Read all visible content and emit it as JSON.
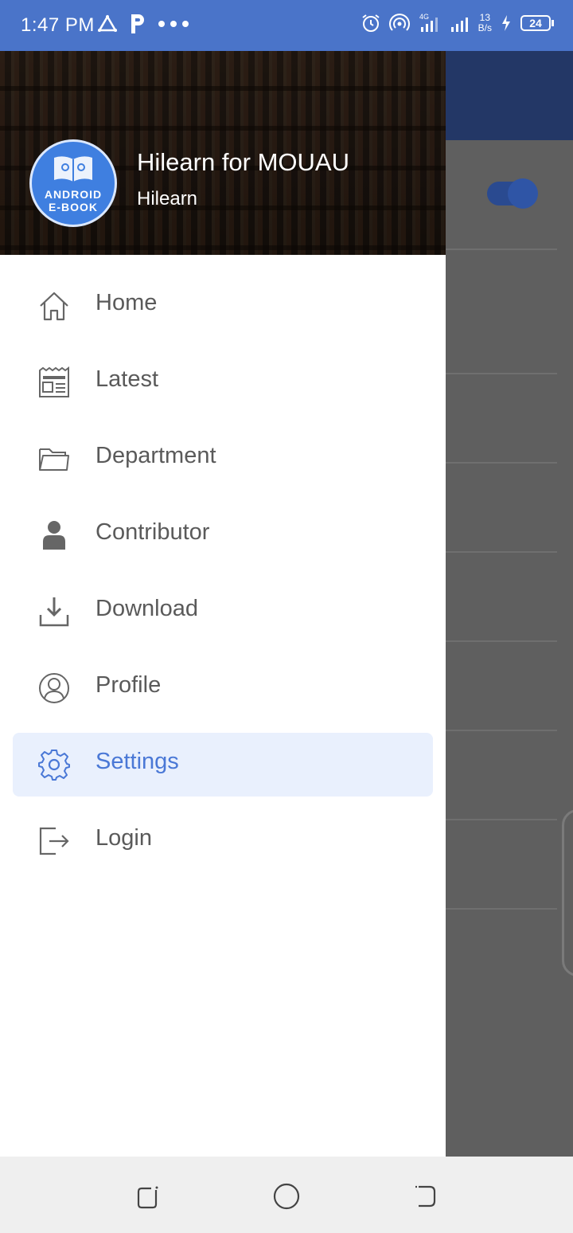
{
  "status_bar": {
    "time": "1:47 PM",
    "net_speed_top": "13",
    "net_speed_bottom": "B/s",
    "network_type": "4G",
    "battery": "24",
    "icons": [
      "warning-triangle-icon",
      "p-icon",
      "more-dots-icon",
      "alarm-icon",
      "hotspot-icon",
      "signal-icon",
      "signal-icon",
      "charging-icon",
      "battery-icon"
    ]
  },
  "drawer": {
    "header": {
      "title": "Hilearn for MOUAU",
      "subtitle": "Hilearn",
      "logo_line1": "ANDROID",
      "logo_line2": "E-BOOK"
    },
    "items": [
      {
        "label": "Home",
        "icon": "home-icon"
      },
      {
        "label": "Latest",
        "icon": "newspaper-icon"
      },
      {
        "label": "Department",
        "icon": "folder-icon"
      },
      {
        "label": "Contributor",
        "icon": "person-icon"
      },
      {
        "label": "Download",
        "icon": "download-icon"
      },
      {
        "label": "Profile",
        "icon": "profile-circle-icon"
      },
      {
        "label": "Settings",
        "icon": "gear-icon",
        "active": true
      },
      {
        "label": "Login",
        "icon": "login-icon"
      }
    ]
  },
  "colors": {
    "status_bar": "#4a74c9",
    "active_item_bg": "#e9f0fd",
    "active_item_text": "#4a78d6",
    "item_text": "#5a5a5a"
  },
  "nav_bar": {
    "buttons": [
      "recent-apps-icon",
      "home-circle-icon",
      "back-icon"
    ]
  }
}
